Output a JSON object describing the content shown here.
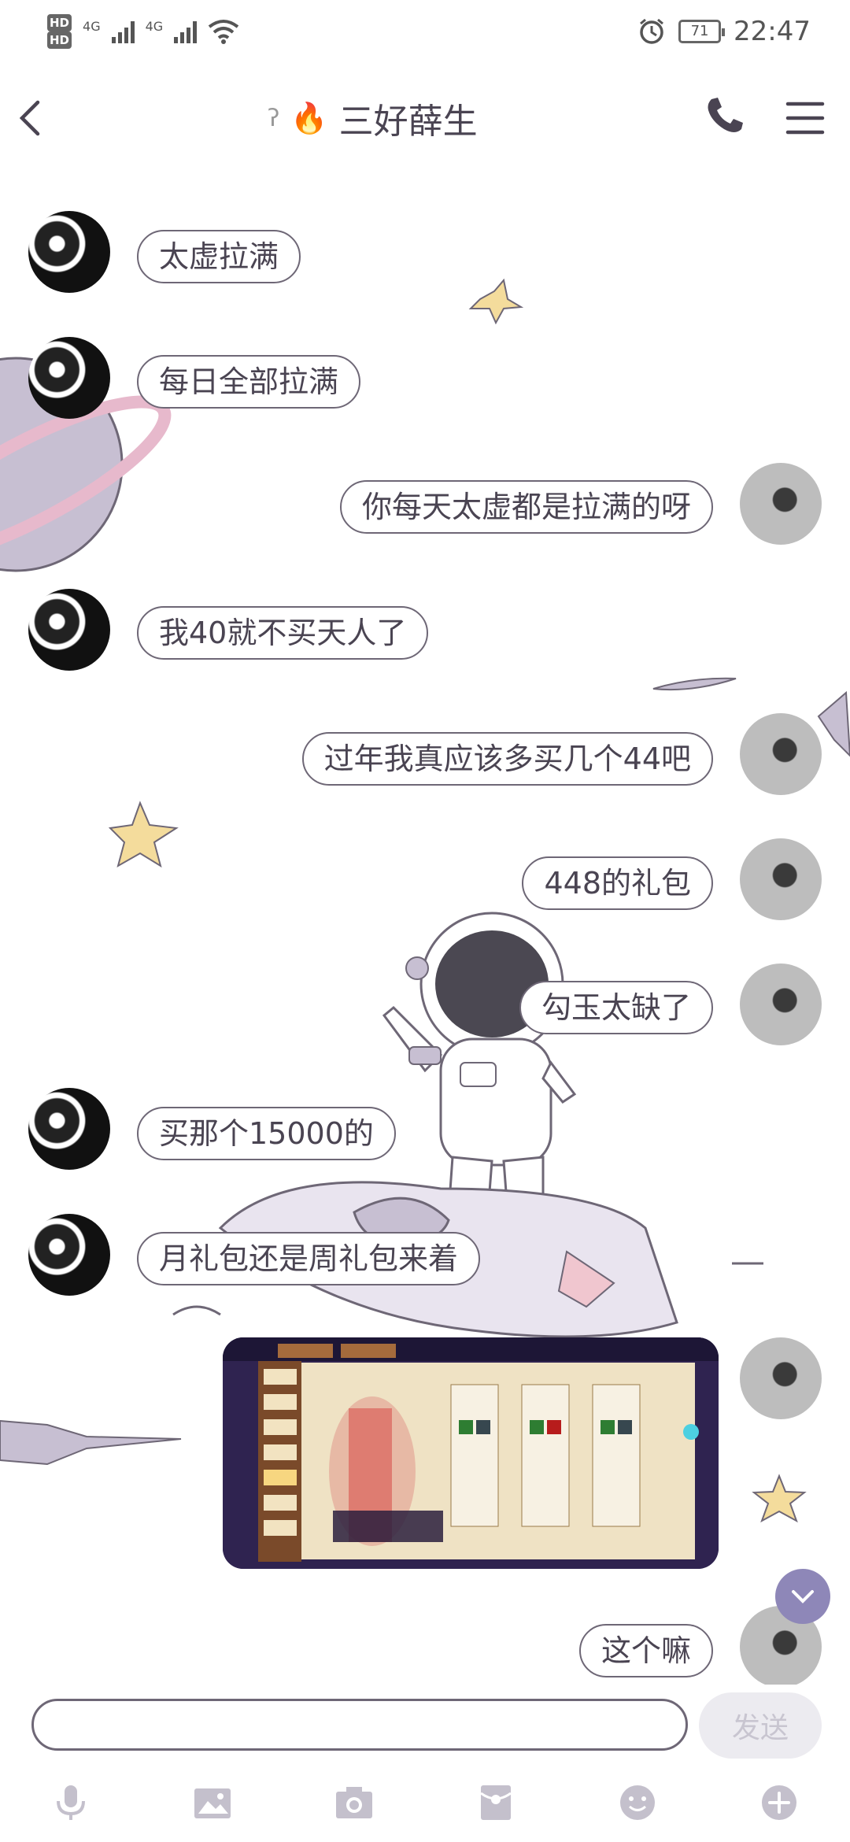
{
  "status": {
    "hd1": "HD",
    "hd2": "HD",
    "net1": "4G",
    "net2": "4G",
    "battery": "71",
    "time": "22:47"
  },
  "header": {
    "title": "三好薛生",
    "flame": "🔥",
    "ear": "ʔ"
  },
  "messages": [
    {
      "sender": "friend",
      "text": "太虚拉满"
    },
    {
      "sender": "friend",
      "text": "每日全部拉满"
    },
    {
      "sender": "me",
      "text": "你每天太虚都是拉满的呀"
    },
    {
      "sender": "friend",
      "text": "我40就不买天人了"
    },
    {
      "sender": "me",
      "text": "过年我真应该多买几个44吧"
    },
    {
      "sender": "me",
      "text": "448的礼包"
    },
    {
      "sender": "me",
      "text": "勾玉太缺了"
    },
    {
      "sender": "friend",
      "text": "买那个15000的"
    },
    {
      "sender": "friend",
      "text": "月礼包还是周礼包来着"
    },
    {
      "sender": "me",
      "type": "image"
    },
    {
      "sender": "me",
      "text": "这个嘛"
    }
  ],
  "input": {
    "send_label": "发送",
    "placeholder": ""
  },
  "toolbar": {
    "icons": [
      "mic-icon",
      "picture-icon",
      "camera-icon",
      "red-packet-icon",
      "emoji-icon",
      "plus-icon"
    ]
  },
  "colors": {
    "bubble_border": "#6e6776",
    "text": "#4a4452",
    "accent": "#8e87b8"
  }
}
